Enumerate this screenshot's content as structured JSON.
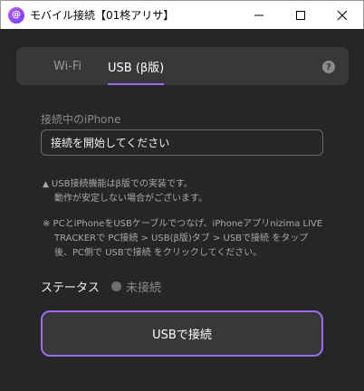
{
  "window": {
    "title": "モバイル接続【01柊アリサ】",
    "app_icon_glyph": "@",
    "controls": {
      "minimize": "—",
      "maximize": "□",
      "close": "✕"
    }
  },
  "tabs": [
    {
      "label": "Wi-Fi",
      "active": false
    },
    {
      "label": "USB (β版)",
      "active": true
    }
  ],
  "help_icon": "?",
  "device": {
    "label": "接続中のiPhone",
    "value": "接続を開始してください"
  },
  "notes": {
    "warning_line1": "USB接続機能はβ版での実装です。",
    "warning_line2": "動作が安定しない場合がございます。",
    "info_line1": "※ PCとiPhoneをUSBケーブルでつなげ、iPhoneアプリnizima LIVE",
    "info_line2": "TRACKERで PC接続 > USB(β版)タブ > USBで接続 をタップ",
    "info_line3": "後、PC側で USBで接続 をクリックしてください。"
  },
  "status": {
    "label": "ステータス",
    "value": "未接続"
  },
  "connect_button": "USBで接続",
  "colors": {
    "accent": "#9b6cf7",
    "background": "#262626",
    "panel": "#383838"
  }
}
